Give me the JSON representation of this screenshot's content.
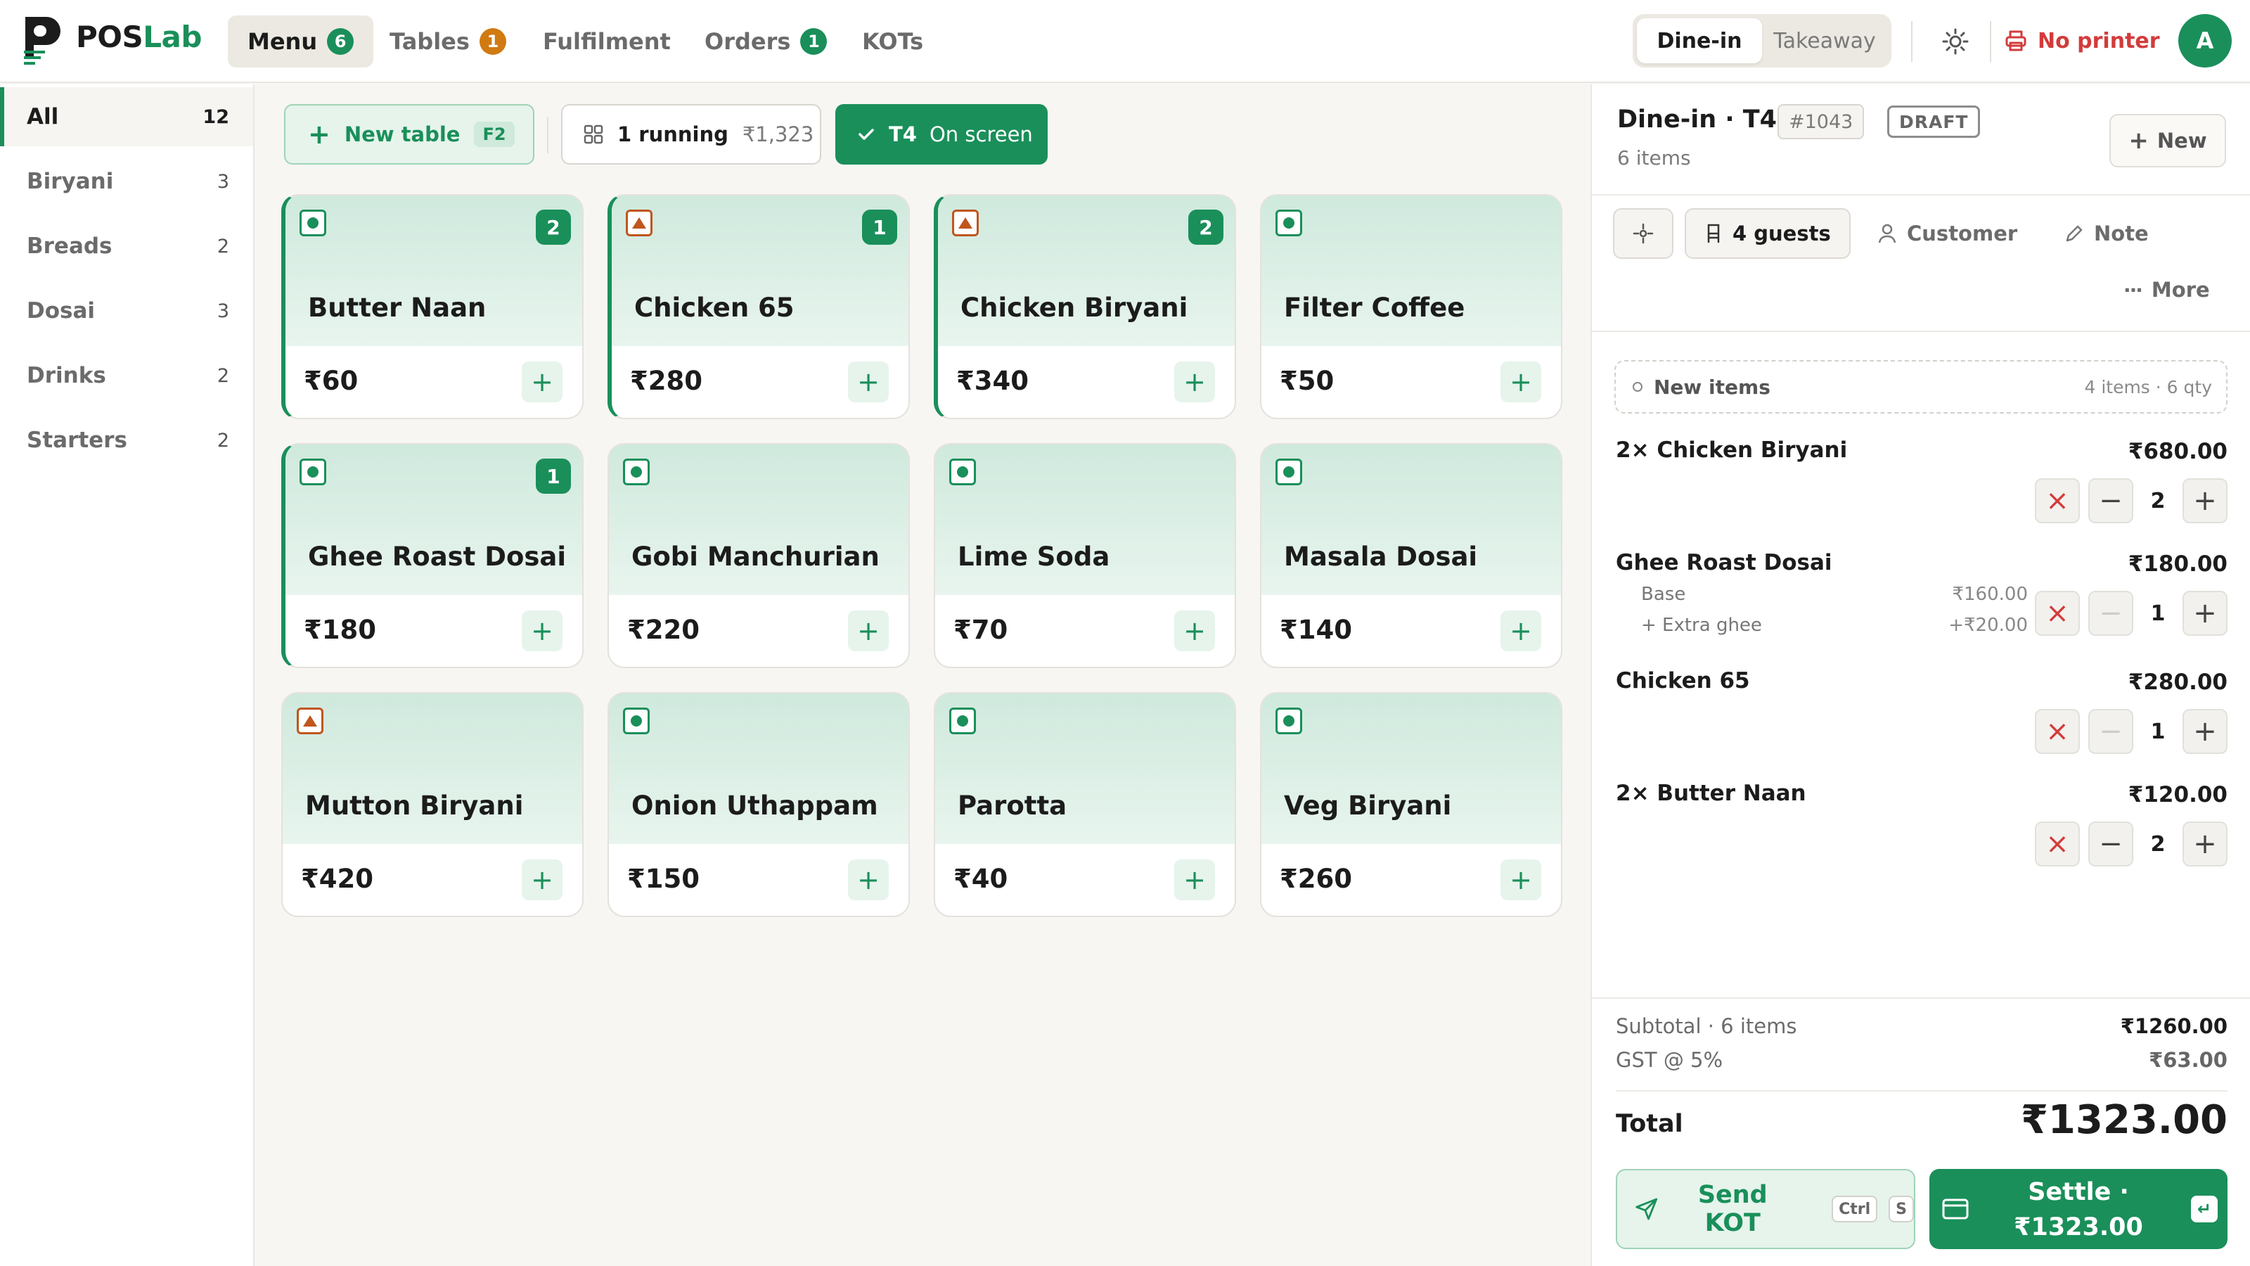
{
  "app": {
    "brand_a": "POS",
    "brand_b": "Lab"
  },
  "nav": {
    "menu": {
      "label": "Menu",
      "badge": "6"
    },
    "tables": {
      "label": "Tables",
      "badge": "1"
    },
    "fulfilment": {
      "label": "Fulfilment"
    },
    "orders": {
      "label": "Orders",
      "badge": "1"
    },
    "kots": {
      "label": "KOTs"
    }
  },
  "mode": {
    "dine_in": "Dine-in",
    "takeaway": "Takeaway"
  },
  "printer": {
    "label": "No printer"
  },
  "user": {
    "initial": "A"
  },
  "categories": [
    {
      "label": "All",
      "count": "12"
    },
    {
      "label": "Biryani",
      "count": "3"
    },
    {
      "label": "Breads",
      "count": "2"
    },
    {
      "label": "Dosai",
      "count": "3"
    },
    {
      "label": "Drinks",
      "count": "2"
    },
    {
      "label": "Starters",
      "count": "2"
    }
  ],
  "actions": {
    "new_table": "New table",
    "new_table_key": "F2",
    "running": "1 running",
    "running_amount": "₹1,323",
    "table": "T4",
    "table_status": "On screen"
  },
  "menu_items": [
    {
      "name": "Butter Naan",
      "price": "₹60",
      "qty": "2",
      "type": "veg"
    },
    {
      "name": "Chicken 65",
      "price": "₹280",
      "qty": "1",
      "type": "nonveg"
    },
    {
      "name": "Chicken Biryani",
      "price": "₹340",
      "qty": "2",
      "type": "nonveg"
    },
    {
      "name": "Filter Coffee",
      "price": "₹50",
      "qty": "",
      "type": "veg"
    },
    {
      "name": "Ghee Roast Dosai",
      "price": "₹180",
      "qty": "1",
      "type": "veg"
    },
    {
      "name": "Gobi Manchurian",
      "price": "₹220",
      "qty": "",
      "type": "veg"
    },
    {
      "name": "Lime Soda",
      "price": "₹70",
      "qty": "",
      "type": "veg"
    },
    {
      "name": "Masala Dosai",
      "price": "₹140",
      "qty": "",
      "type": "veg"
    },
    {
      "name": "Mutton Biryani",
      "price": "₹420",
      "qty": "",
      "type": "nonveg"
    },
    {
      "name": "Onion Uthappam",
      "price": "₹150",
      "qty": "",
      "type": "veg"
    },
    {
      "name": "Parotta",
      "price": "₹40",
      "qty": "",
      "type": "veg"
    },
    {
      "name": "Veg Biryani",
      "price": "₹260",
      "qty": "",
      "type": "veg"
    }
  ],
  "order": {
    "title": "Dine-in · T4",
    "id": "#1043",
    "status": "DRAFT",
    "new_label": "New",
    "item_count": "6 items",
    "guests": "4 guests",
    "customer": "Customer",
    "note": "Note",
    "more": "More",
    "new_items_label": "New items",
    "new_items_summary": "4 items · 6 qty",
    "lines": [
      {
        "name": "2× Chicken Biryani",
        "amount": "₹680.00",
        "qty": "2"
      },
      {
        "name": "Ghee Roast Dosai",
        "amount": "₹180.00",
        "qty": "1",
        "mods": [
          {
            "label": "Base",
            "amount": "₹160.00"
          },
          {
            "label": "+ Extra ghee",
            "amount": "+₹20.00"
          }
        ]
      },
      {
        "name": "Chicken 65",
        "amount": "₹280.00",
        "qty": "1"
      },
      {
        "name": "2× Butter Naan",
        "amount": "₹120.00",
        "qty": "2"
      }
    ],
    "subtotal_label": "Subtotal · 6 items",
    "subtotal": "₹1260.00",
    "gst_label": "GST @ 5%",
    "gst": "₹63.00",
    "total_label": "Total",
    "total": "₹1323.00",
    "send_kot": "Send KOT",
    "kot_key_1": "Ctrl",
    "kot_key_2": "S",
    "settle_line1": "Settle ·",
    "settle_line2": "₹1323.00",
    "settle_key": "↵"
  },
  "colors": {
    "accent": "#1a8f5a",
    "danger": "#d33b3b",
    "nonveg": "#c0561d",
    "warning": "#d07a12"
  }
}
